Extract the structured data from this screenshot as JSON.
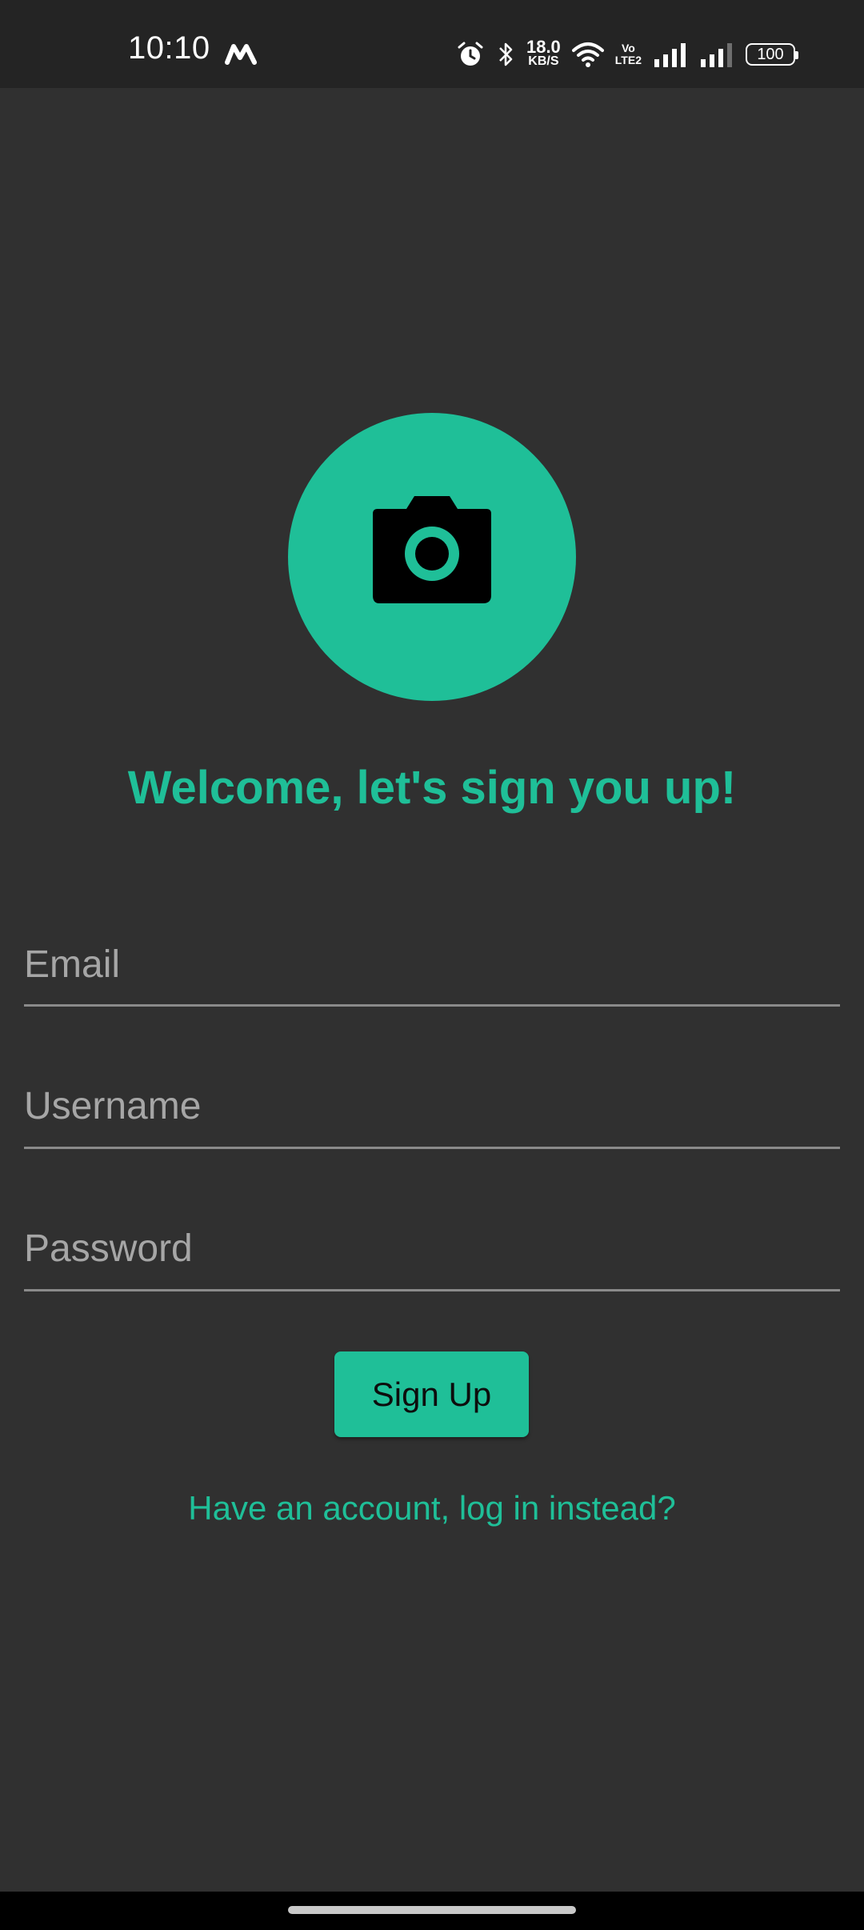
{
  "status_bar": {
    "time": "10:10",
    "network_speed_value": "18.0",
    "network_speed_unit": "KB/S",
    "volte_top": "Vo",
    "volte_bottom": "LTE2",
    "battery": "100",
    "icons": [
      "m-app-icon",
      "alarm-icon",
      "bluetooth-icon",
      "wifi-icon",
      "signal-icon",
      "battery-icon"
    ]
  },
  "header": {
    "logo_icon": "camera-icon",
    "welcome_text": "Welcome, let's sign you up!"
  },
  "form": {
    "email_placeholder": "Email",
    "username_placeholder": "Username",
    "password_placeholder": "Password",
    "signup_label": "Sign Up",
    "login_link": "Have an account, log in instead?"
  },
  "colors": {
    "accent": "#1fbf98",
    "background": "#303030",
    "status_bar": "#242424"
  }
}
